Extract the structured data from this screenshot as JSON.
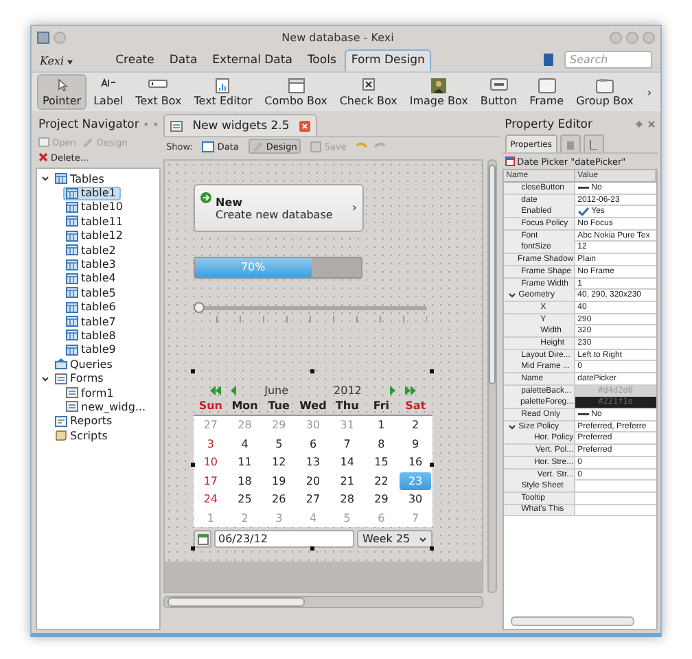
{
  "window": {
    "title": "New database - Kexi"
  },
  "ribbon": {
    "app_menu": "Kexi",
    "tabs": [
      {
        "label": "Create",
        "selected": false
      },
      {
        "label": "Data",
        "selected": false
      },
      {
        "label": "External Data",
        "selected": false
      },
      {
        "label": "Tools",
        "selected": false
      },
      {
        "label": "Form Design",
        "selected": true
      }
    ],
    "search": {
      "placeholder": "Search"
    }
  },
  "toolbar": {
    "items": [
      {
        "label": "Pointer",
        "kind": "pointer",
        "selected": true
      },
      {
        "label": "Label",
        "kind": "label",
        "selected": false
      },
      {
        "label": "Text Box",
        "kind": "textbox",
        "selected": false
      },
      {
        "label": "Text Editor",
        "kind": "texteditor",
        "selected": false
      },
      {
        "label": "Combo Box",
        "kind": "combobox",
        "selected": false
      },
      {
        "label": "Check Box",
        "kind": "checkbox",
        "selected": false
      },
      {
        "label": "Image Box",
        "kind": "imagebox",
        "selected": false
      },
      {
        "label": "Button",
        "kind": "button",
        "selected": false
      },
      {
        "label": "Frame",
        "kind": "frame",
        "selected": false
      },
      {
        "label": "Group Box",
        "kind": "groupbox",
        "selected": false
      }
    ],
    "overflow": "›"
  },
  "navigator": {
    "title": "Project Navigator",
    "actions": [
      {
        "label": "Open",
        "kind": "open",
        "disabled": true
      },
      {
        "label": "Design",
        "kind": "design",
        "disabled": true
      },
      {
        "label": "Delete...",
        "kind": "delete",
        "disabled": false
      }
    ],
    "tree": [
      {
        "label": "Tables",
        "kind": "tables",
        "expanded": true,
        "children": [
          {
            "label": "table1",
            "kind": "table",
            "selected": true
          },
          {
            "label": "table10",
            "kind": "table",
            "selected": false
          },
          {
            "label": "table11",
            "kind": "table",
            "selected": false
          },
          {
            "label": "table12",
            "kind": "table",
            "selected": false
          },
          {
            "label": "table2",
            "kind": "table",
            "selected": false
          },
          {
            "label": "table3",
            "kind": "table",
            "selected": false
          },
          {
            "label": "table4",
            "kind": "table",
            "selected": false
          },
          {
            "label": "table5",
            "kind": "table",
            "selected": false
          },
          {
            "label": "table6",
            "kind": "table",
            "selected": false
          },
          {
            "label": "table7",
            "kind": "table",
            "selected": false
          },
          {
            "label": "table8",
            "kind": "table",
            "selected": false
          },
          {
            "label": "table9",
            "kind": "table",
            "selected": false
          }
        ]
      },
      {
        "label": "Queries",
        "kind": "queries",
        "expanded": false
      },
      {
        "label": "Forms",
        "kind": "forms",
        "expanded": true,
        "children": [
          {
            "label": "form1",
            "kind": "form",
            "selected": false
          },
          {
            "label": "new_widg...",
            "kind": "form",
            "selected": false
          }
        ]
      },
      {
        "label": "Reports",
        "kind": "reports",
        "expanded": false
      },
      {
        "label": "Scripts",
        "kind": "scripts",
        "expanded": false
      }
    ]
  },
  "document": {
    "tab": "New widgets 2.5",
    "show_label": "Show:",
    "views": [
      {
        "label": "Data",
        "kind": "data",
        "selected": false,
        "disabled": false
      },
      {
        "label": "Design",
        "kind": "design",
        "selected": true,
        "disabled": false
      },
      {
        "label": "Save",
        "kind": "save",
        "selected": false,
        "disabled": true
      }
    ],
    "command_link": {
      "title": "New",
      "subtitle": "Create new database",
      "chevron": "›"
    },
    "progress": {
      "level": 0.7,
      "text": "70%"
    },
    "slider": {
      "level": 0.0
    },
    "date_picker": {
      "month": "June",
      "year": "2012",
      "weekdays": [
        {
          "label": "Sun",
          "holiday": true
        },
        {
          "label": "Mon",
          "holiday": false
        },
        {
          "label": "Tue",
          "holiday": false
        },
        {
          "label": "Wed",
          "holiday": false
        },
        {
          "label": "Thu",
          "holiday": false
        },
        {
          "label": "Fri",
          "holiday": false
        },
        {
          "label": "Sat",
          "holiday": true
        }
      ],
      "weeks": [
        [
          {
            "text": "27",
            "muted": true,
            "holiday": false,
            "selected": false
          },
          {
            "text": "28",
            "muted": true,
            "holiday": false,
            "selected": false
          },
          {
            "text": "29",
            "muted": true,
            "holiday": false,
            "selected": false
          },
          {
            "text": "30",
            "muted": true,
            "holiday": false,
            "selected": false
          },
          {
            "text": "31",
            "muted": true,
            "holiday": false,
            "selected": false
          },
          {
            "text": "1",
            "muted": false,
            "holiday": false,
            "selected": false
          },
          {
            "text": "2",
            "muted": false,
            "holiday": false,
            "selected": false
          }
        ],
        [
          {
            "text": "3",
            "muted": false,
            "holiday": true,
            "selected": false
          },
          {
            "text": "4",
            "muted": false,
            "holiday": false,
            "selected": false
          },
          {
            "text": "5",
            "muted": false,
            "holiday": false,
            "selected": false
          },
          {
            "text": "6",
            "muted": false,
            "holiday": false,
            "selected": false
          },
          {
            "text": "7",
            "muted": false,
            "holiday": false,
            "selected": false
          },
          {
            "text": "8",
            "muted": false,
            "holiday": false,
            "selected": false
          },
          {
            "text": "9",
            "muted": false,
            "holiday": false,
            "selected": false
          }
        ],
        [
          {
            "text": "10",
            "muted": false,
            "holiday": true,
            "selected": false
          },
          {
            "text": "11",
            "muted": false,
            "holiday": false,
            "selected": false
          },
          {
            "text": "12",
            "muted": false,
            "holiday": false,
            "selected": false
          },
          {
            "text": "13",
            "muted": false,
            "holiday": false,
            "selected": false
          },
          {
            "text": "14",
            "muted": false,
            "holiday": false,
            "selected": false
          },
          {
            "text": "15",
            "muted": false,
            "holiday": false,
            "selected": false
          },
          {
            "text": "16",
            "muted": false,
            "holiday": false,
            "selected": false
          }
        ],
        [
          {
            "text": "17",
            "muted": false,
            "holiday": true,
            "selected": false
          },
          {
            "text": "18",
            "muted": false,
            "holiday": false,
            "selected": false
          },
          {
            "text": "19",
            "muted": false,
            "holiday": false,
            "selected": false
          },
          {
            "text": "20",
            "muted": false,
            "holiday": false,
            "selected": false
          },
          {
            "text": "21",
            "muted": false,
            "holiday": false,
            "selected": false
          },
          {
            "text": "22",
            "muted": false,
            "holiday": false,
            "selected": false
          },
          {
            "text": "23",
            "muted": false,
            "holiday": false,
            "selected": true
          }
        ],
        [
          {
            "text": "24",
            "muted": false,
            "holiday": true,
            "selected": false
          },
          {
            "text": "25",
            "muted": false,
            "holiday": false,
            "selected": false
          },
          {
            "text": "26",
            "muted": false,
            "holiday": false,
            "selected": false
          },
          {
            "text": "27",
            "muted": false,
            "holiday": false,
            "selected": false
          },
          {
            "text": "28",
            "muted": false,
            "holiday": false,
            "selected": false
          },
          {
            "text": "29",
            "muted": false,
            "holiday": false,
            "selected": false
          },
          {
            "text": "30",
            "muted": false,
            "holiday": false,
            "selected": false
          }
        ],
        [
          {
            "text": "1",
            "muted": true,
            "holiday": false,
            "selected": false
          },
          {
            "text": "2",
            "muted": true,
            "holiday": false,
            "selected": false
          },
          {
            "text": "3",
            "muted": true,
            "holiday": false,
            "selected": false
          },
          {
            "text": "4",
            "muted": true,
            "holiday": false,
            "selected": false
          },
          {
            "text": "5",
            "muted": true,
            "holiday": false,
            "selected": false
          },
          {
            "text": "6",
            "muted": true,
            "holiday": false,
            "selected": false
          },
          {
            "text": "7",
            "muted": true,
            "holiday": false,
            "selected": false
          }
        ]
      ],
      "date_field": "06/23/12",
      "week": "Week 25"
    }
  },
  "properties": {
    "title": "Property Editor",
    "tab": "Properties",
    "object": "Date Picker \"datePicker\"",
    "columns": [
      "Name",
      "Value"
    ],
    "rows": [
      {
        "name": "closeButton",
        "value": "No",
        "kind": "bool",
        "checked": false
      },
      {
        "name": "date",
        "value": "2012-06-23",
        "kind": "text"
      },
      {
        "name": "Enabled",
        "value": "Yes",
        "kind": "bool",
        "checked": true
      },
      {
        "name": "Focus Policy",
        "value": "No Focus",
        "kind": "text"
      },
      {
        "name": "Font",
        "value": "Abc Nokia Pure Tex",
        "kind": "text"
      },
      {
        "name": "fontSize",
        "value": "12",
        "kind": "text"
      },
      {
        "name": "Frame Shadow",
        "value": "Plain",
        "kind": "text"
      },
      {
        "name": "Frame Shape",
        "value": "No Frame",
        "kind": "text"
      },
      {
        "name": "Frame Width",
        "value": "1",
        "kind": "text"
      },
      {
        "name": "Geometry",
        "value": "40, 290, 320x230",
        "kind": "text",
        "expanded": true,
        "children": [
          {
            "name": "X",
            "value": "40",
            "kind": "text"
          },
          {
            "name": "Y",
            "value": "290",
            "kind": "text"
          },
          {
            "name": "Width",
            "value": "320",
            "kind": "text"
          },
          {
            "name": "Height",
            "value": "230",
            "kind": "text"
          }
        ]
      },
      {
        "name": "Layout Dire...",
        "value": "Left to Right",
        "kind": "text"
      },
      {
        "name": "Mid Frame ...",
        "value": "0",
        "kind": "text"
      },
      {
        "name": "Name",
        "value": "datePicker",
        "kind": "text"
      },
      {
        "name": "paletteBack...",
        "value": "#d4d2d0",
        "kind": "color",
        "color": "#d4d2d0"
      },
      {
        "name": "paletteForeg...",
        "value": "#221f1e",
        "kind": "color",
        "color": "#221f1e"
      },
      {
        "name": "Read Only",
        "value": "No",
        "kind": "bool",
        "checked": false
      },
      {
        "name": "Size Policy",
        "value": "Preferred, Preferre",
        "kind": "text",
        "expanded": true,
        "children": [
          {
            "name": "Hor. Policy",
            "value": "Preferred",
            "kind": "text"
          },
          {
            "name": "Vert. Pol...",
            "value": "Preferred",
            "kind": "text"
          },
          {
            "name": "Hor. Stre...",
            "value": "0",
            "kind": "text"
          },
          {
            "name": "Vert. Str...",
            "value": "0",
            "kind": "text"
          }
        ]
      },
      {
        "name": "Style Sheet",
        "value": "",
        "kind": "text"
      },
      {
        "name": "Tooltip",
        "value": "",
        "kind": "text"
      },
      {
        "name": "What's This",
        "value": "",
        "kind": "text"
      }
    ]
  }
}
